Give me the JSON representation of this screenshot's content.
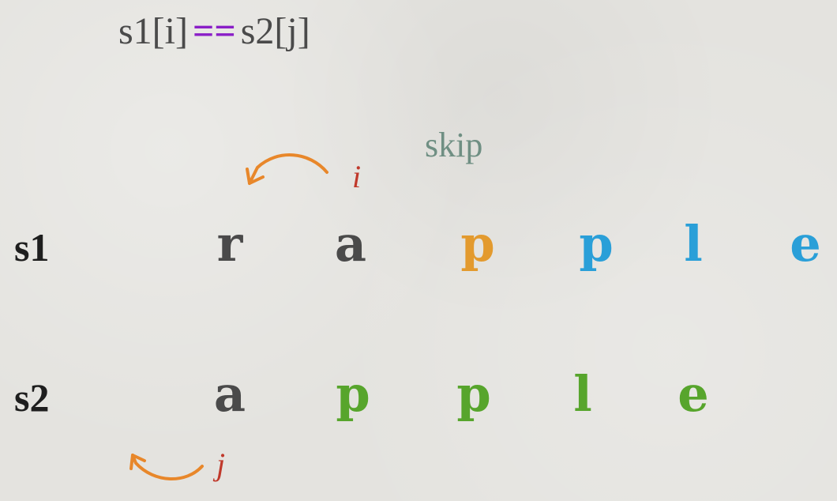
{
  "title": {
    "left": "s1[i]",
    "operator": "==",
    "right": "s2[j]"
  },
  "skip_label": "skip",
  "colors": {
    "default": "#4a4a4a",
    "skipped": "#e39a2e",
    "unmatched": "#2a9fd8",
    "matched": "#57a52c",
    "operator": "#8a1ec7",
    "pointer": "#c0392b",
    "arrow": "#e8872a"
  },
  "rows": [
    {
      "label": "s1",
      "chars": [
        {
          "ch": "r",
          "state": "default"
        },
        {
          "ch": "a",
          "state": "default"
        },
        {
          "ch": "p",
          "state": "skipped"
        },
        {
          "ch": "p",
          "state": "unmatched"
        },
        {
          "ch": "l",
          "state": "unmatched"
        },
        {
          "ch": "e",
          "state": "unmatched"
        }
      ]
    },
    {
      "label": "s2",
      "chars": [
        {
          "ch": "a",
          "state": "default"
        },
        {
          "ch": "p",
          "state": "matched"
        },
        {
          "ch": "p",
          "state": "matched"
        },
        {
          "ch": "l",
          "state": "matched"
        },
        {
          "ch": "e",
          "state": "matched"
        }
      ]
    }
  ],
  "pointers": [
    {
      "label": "i",
      "icon": "curved-arrow-left-icon"
    },
    {
      "label": "j",
      "icon": "curved-arrow-left-icon"
    }
  ]
}
